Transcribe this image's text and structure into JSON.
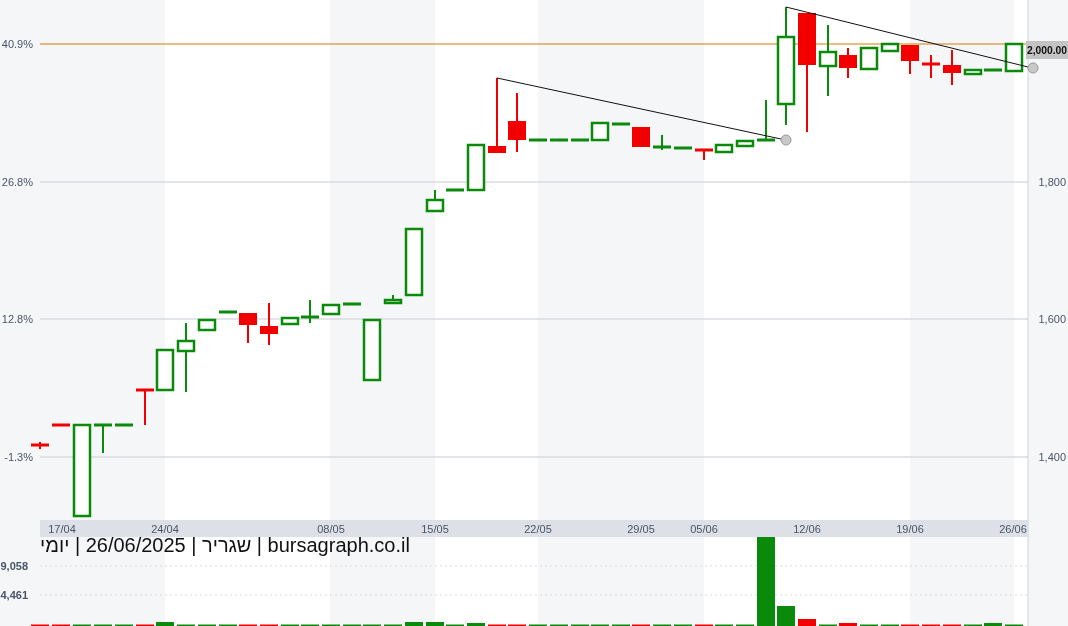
{
  "price_chart": {
    "left_axis_labels": [
      "40.9%",
      "26.8%",
      "12.8%",
      "-1.3%"
    ],
    "right_axis_labels": [
      "1,800",
      "1,600",
      "1,400"
    ],
    "last_price_tag": "2,000.00",
    "date_labels": [
      "17/04",
      "24/04",
      "08/05",
      "15/05",
      "22/05",
      "29/05",
      "05/06",
      "12/06",
      "19/06",
      "26/06"
    ]
  },
  "caption": "bursagraph.co.il | שגריר | 26/06/2025 | יומי",
  "volume_chart": {
    "axis_labels": [
      "9,058",
      "4,461"
    ]
  }
}
